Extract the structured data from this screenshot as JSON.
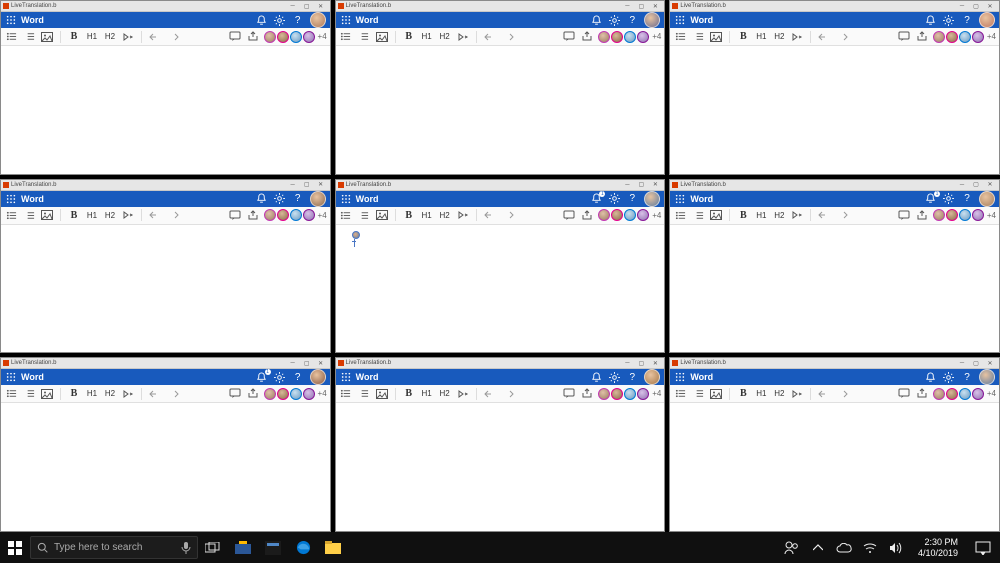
{
  "window_title": "LiveTranslation.b",
  "app_name": "Word",
  "notif_badge": "1",
  "toolbar": {
    "bold": "B",
    "h1": "H1",
    "h2": "H2"
  },
  "presence": {
    "more": "+4",
    "colors": [
      "#c239b3",
      "#e3008c",
      "#0078d4",
      "#881798"
    ]
  },
  "avatars": {
    "a0": {
      "bg": "#b07a5a"
    },
    "a1": {
      "bg": "#6b6b8f"
    },
    "a2": {
      "bg": "#c07860"
    },
    "a3": {
      "bg": "#8c6a50"
    },
    "a4": {
      "bg": "#5e7ba0"
    },
    "a5": {
      "bg": "#a8805e"
    },
    "a6": {
      "bg": "#8a5a42"
    },
    "a7": {
      "bg": "#a87848"
    },
    "a8": {
      "bg": "#5e7ba0"
    }
  },
  "notif_badges": [
    false,
    false,
    false,
    false,
    true,
    true,
    true,
    false,
    false
  ],
  "taskbar": {
    "search_placeholder": "Type here to search",
    "time": "2:30 PM",
    "date": "4/10/2019"
  }
}
